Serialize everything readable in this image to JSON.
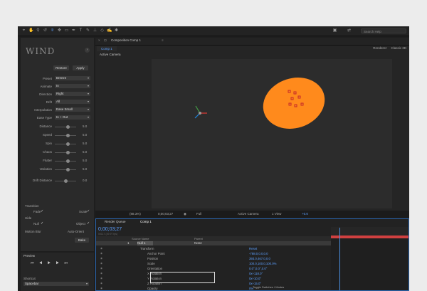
{
  "toolbar": {
    "search_placeholder": "Search Help"
  },
  "wind_panel": {
    "logo": "WIND",
    "restore_label": "Restore",
    "apply_label": "Apply",
    "rows": [
      {
        "label": "Preset",
        "value": "Breeze"
      },
      {
        "label": "Animate",
        "value": "In"
      },
      {
        "label": "Direction",
        "value": "Right"
      },
      {
        "label": "Drift",
        "value": "All"
      },
      {
        "label": "Interpolation",
        "value": "Ease Small"
      },
      {
        "label": "Ease Type",
        "value": "In + Out"
      }
    ],
    "sliders": [
      {
        "label": "Distance",
        "value": "5.0",
        "level": 0.6
      },
      {
        "label": "Speed",
        "value": "5.0",
        "level": 0.6
      },
      {
        "label": "Spin",
        "value": "5.0",
        "level": 0.6
      },
      {
        "label": "Chaos",
        "value": "5.0",
        "level": 0.6
      },
      {
        "label": "Flutter",
        "value": "5.0",
        "level": 0.6
      },
      {
        "label": "Variation",
        "value": "5.0",
        "level": 0.6
      },
      {
        "label": "Drift Distance",
        "value": "0.0",
        "level": 0.5
      }
    ],
    "transition_label": "Transition",
    "fade_label": "Fade",
    "scale_label": "Scale",
    "hide_label": "Hide",
    "null_label": "Null",
    "object_label": "Object",
    "motion_blur_label": "Motion Blur",
    "auto_orient_label": "Auto-Orient",
    "bake_label": "Bake"
  },
  "preview": {
    "title": "Preview",
    "shortcut_label": "Shortcut",
    "shortcut_value": "Spacebar"
  },
  "viewer": {
    "tab_label": "Composition Comp 1",
    "subtab_label": "Comp 1",
    "renderer_label": "Renderer:",
    "renderer_value": "Classic 3D",
    "active_camera": "Active Camera",
    "zoom": "(88.3%)",
    "timecode": "0;00;03;27",
    "resolution": "Full",
    "camera_select": "Active Camera",
    "view_select": "1 View",
    "exposure": "+0.0"
  },
  "timeline": {
    "render_queue_tab": "Render Queue",
    "comp_tab": "Comp 1",
    "timecode": "0;00;03;27",
    "subcode": "00117 (29.97 fps)",
    "source_name_header": "Source Name",
    "parent_header": "Parent",
    "layer_num": "1",
    "layer_name": "Null 1",
    "layer_parent": "None",
    "props": [
      {
        "name": "Transform",
        "value": "Reset"
      },
      {
        "name": "Anchor Point",
        "value": "-788.0,0.0,0.0"
      },
      {
        "name": "Position",
        "value": "393.0,467.0,0.0"
      },
      {
        "name": "Scale",
        "value": "100.0,100.0,100.0%"
      },
      {
        "name": "Orientation",
        "value": "0.0°,0.0°,0.0°"
      },
      {
        "name": "X Rotation",
        "value": "0x+118.0°"
      },
      {
        "name": "Y Rotation",
        "value": "0x+10.0°"
      },
      {
        "name": "Z Rotation",
        "value": "0x+15.0°"
      },
      {
        "name": "Opacity",
        "value": "0%"
      }
    ],
    "toggle_label": "Toggle Switches / Modes"
  }
}
